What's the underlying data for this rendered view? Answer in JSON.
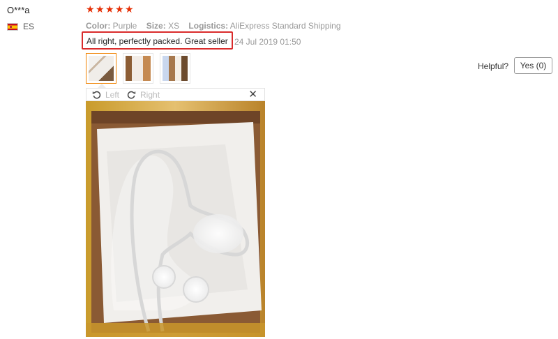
{
  "reviewer": {
    "name": "O***a",
    "country_code": "ES"
  },
  "rating": {
    "stars": 5,
    "max": 5,
    "color": "#e62e04"
  },
  "properties": [
    {
      "key": "Color:",
      "value": "Purple"
    },
    {
      "key": "Size:",
      "value": "XS"
    },
    {
      "key": "Logistics:",
      "value": "AliExpress Standard Shipping"
    }
  ],
  "feedback": {
    "text": "All right, perfectly packed. Great seller",
    "highlight_color": "#d92b2b"
  },
  "date": "24 Jul 2019 01:50",
  "thumbnails": {
    "count": 3,
    "active_index": 0,
    "active_border": "#f08200"
  },
  "viewer": {
    "rotate_left_label": "Left",
    "rotate_right_label": "Right",
    "close_icon": "close-icon"
  },
  "helpful": {
    "label": "Helpful?",
    "yes_button": "Yes (0)"
  }
}
